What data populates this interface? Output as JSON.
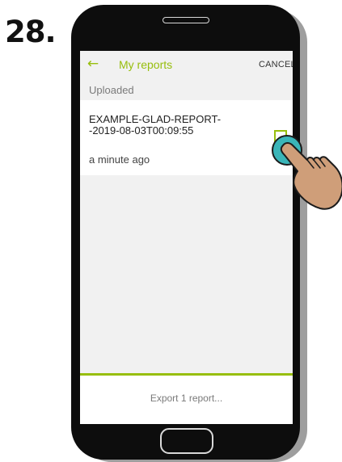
{
  "step": {
    "number": "28."
  },
  "app_bar": {
    "back_icon": "arrow-left-icon",
    "title": "My reports",
    "cancel_label": "CANCEL"
  },
  "section": {
    "label": "Uploaded"
  },
  "report": {
    "name": "EXAMPLE-GLAD-REPORT--2019-08-03T00:09:55",
    "time": "a minute ago",
    "selected": true
  },
  "footer": {
    "export_label": "Export 1 report..."
  },
  "colors": {
    "accent": "#97be0d",
    "tap": "#3ab5b8",
    "hand": "#cf9e79"
  }
}
